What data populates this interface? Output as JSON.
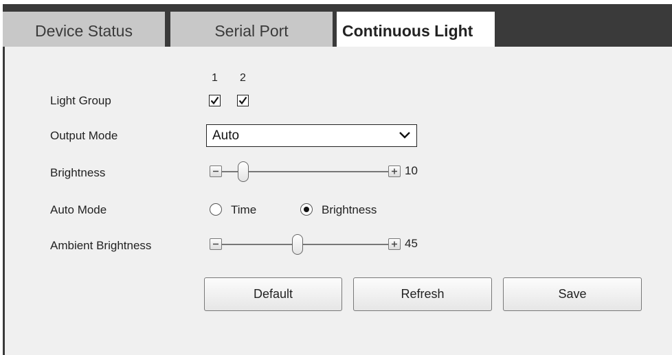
{
  "tabs": [
    {
      "label": "Device Status",
      "active": false
    },
    {
      "label": "Serial Port",
      "active": false
    },
    {
      "label": "Continuous Light",
      "active": true
    }
  ],
  "form": {
    "light_group": {
      "label": "Light Group",
      "options": [
        {
          "number": "1",
          "checked": true
        },
        {
          "number": "2",
          "checked": true
        }
      ]
    },
    "output_mode": {
      "label": "Output Mode",
      "value": "Auto",
      "icon": "chevron-down-icon"
    },
    "brightness": {
      "label": "Brightness",
      "value": "10",
      "min": 0,
      "max": 100,
      "minus_icon": "minus-icon",
      "plus_icon": "plus-icon"
    },
    "auto_mode": {
      "label": "Auto Mode",
      "options": [
        {
          "label": "Time",
          "selected": false
        },
        {
          "label": "Brightness",
          "selected": true
        }
      ]
    },
    "ambient_brightness": {
      "label": "Ambient Brightness",
      "value": "45",
      "min": 0,
      "max": 100,
      "minus_icon": "minus-icon",
      "plus_icon": "plus-icon"
    }
  },
  "buttons": {
    "default_label": "Default",
    "refresh_label": "Refresh",
    "save_label": "Save"
  },
  "colors": {
    "tab_bar": "#3a3a3a",
    "tab_inactive": "#c8c8c8",
    "panel": "#f0f0f0"
  }
}
